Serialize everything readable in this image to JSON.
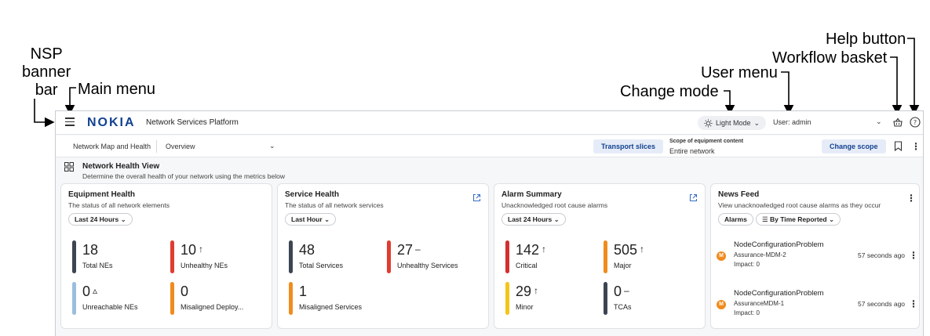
{
  "callouts": {
    "nsp_line1": "NSP",
    "nsp_line2": "banner",
    "nsp_line3": "bar",
    "main_menu": "Main menu",
    "change_mode": "Change mode",
    "user_menu": "User menu",
    "workflow_basket": "Workflow basket",
    "help_button": "Help button"
  },
  "banner": {
    "logo": "NOKIA",
    "product": "Network Services Platform",
    "mode_label": "Light Mode",
    "user_label": "User: admin"
  },
  "subbar": {
    "breadcrumb_1": "Network Map and Health",
    "breadcrumb_2": "Overview",
    "transport_slices": "Transport slices",
    "scope_label": "Scope of equipment content",
    "scope_value": "Entire network",
    "change_scope": "Change scope"
  },
  "view": {
    "title": "Network Health View",
    "subtitle": "Determine the overall health of your network using the metrics below"
  },
  "cards": {
    "equipment": {
      "title": "Equipment Health",
      "subtitle": "The status of all network elements",
      "time_filter": "Last 24 Hours",
      "metrics": [
        {
          "value": "18",
          "trend": "",
          "label": "Total NEs",
          "color": "#3d4452"
        },
        {
          "value": "10",
          "trend": "↑",
          "label": "Unhealthy NEs",
          "color": "#e03c31"
        },
        {
          "value": "0",
          "trend": "▵",
          "label": "Unreachable NEs",
          "color": "#9cbde0"
        },
        {
          "value": "0",
          "trend": "",
          "label": "Misaligned Deploy...",
          "color": "#f08c1e"
        }
      ]
    },
    "service": {
      "title": "Service Health",
      "subtitle": "The status of all network services",
      "time_filter": "Last Hour",
      "metrics": [
        {
          "value": "48",
          "trend": "",
          "label": "Total Services",
          "color": "#3d4452"
        },
        {
          "value": "27",
          "trend": "–",
          "label": "Unhealthy Services",
          "color": "#e03c31"
        },
        {
          "value": "1",
          "trend": "",
          "label": "Misaligned Services",
          "color": "#f08c1e"
        }
      ]
    },
    "alarm": {
      "title": "Alarm Summary",
      "subtitle": "Unacknowledged root cause alarms",
      "time_filter": "Last 24 Hours",
      "metrics": [
        {
          "value": "142",
          "trend": "↑",
          "label": "Critical",
          "color": "#d32f2f"
        },
        {
          "value": "505",
          "trend": "↑",
          "label": "Major",
          "color": "#f08c1e"
        },
        {
          "value": "29",
          "trend": "↑",
          "label": "Minor",
          "color": "#f5c518"
        },
        {
          "value": "0",
          "trend": "–",
          "label": "TCAs",
          "color": "#3d4452"
        }
      ]
    },
    "news": {
      "title": "News Feed",
      "subtitle": "View unacknowledged root cause alarms as they occur",
      "filter_type": "Alarms",
      "sort_label": "By Time Reported",
      "items": [
        {
          "avatar": "M",
          "title": "NodeConfigurationProblem",
          "source": "Assurance-MDM-2",
          "impact": "Impact: 0",
          "time": "57 seconds ago"
        },
        {
          "avatar": "M",
          "title": "NodeConfigurationProblem",
          "source": "AssuranceMDM-1",
          "impact": "Impact: 0",
          "time": "57 seconds ago"
        }
      ]
    }
  }
}
